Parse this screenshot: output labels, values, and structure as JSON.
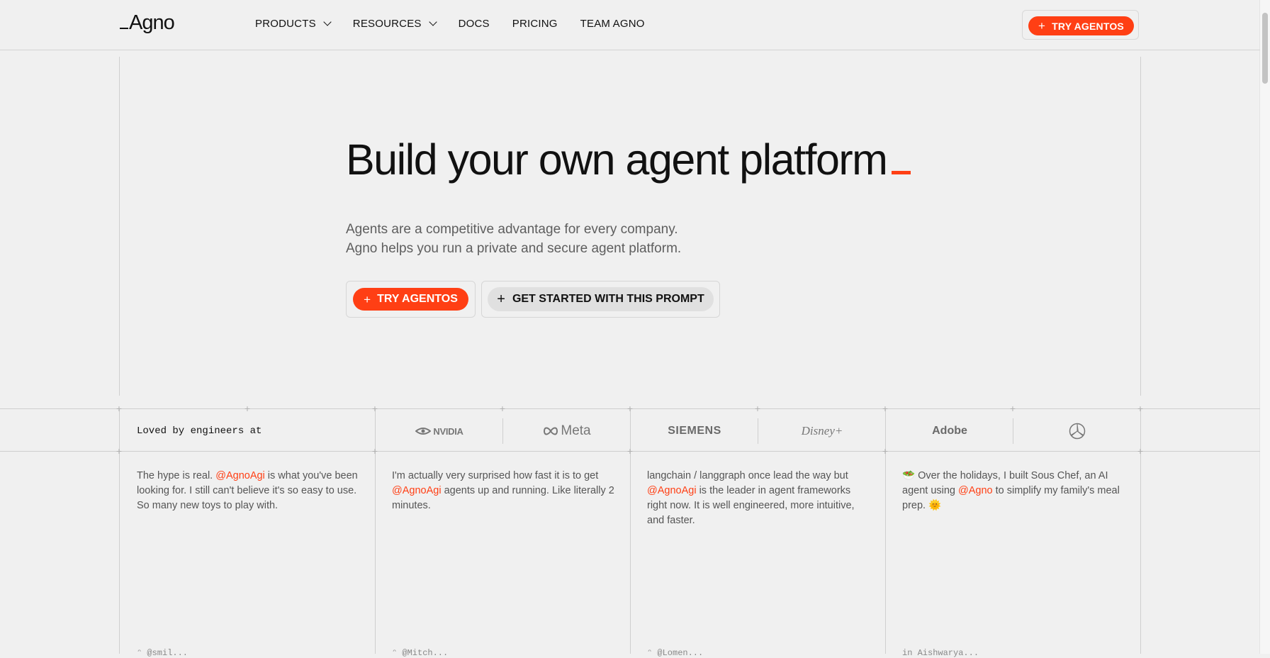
{
  "header": {
    "logo": "Agno",
    "nav": [
      {
        "label": "PRODUCTS",
        "dropdown": true
      },
      {
        "label": "RESOURCES",
        "dropdown": true
      },
      {
        "label": "DOCS",
        "dropdown": false
      },
      {
        "label": "PRICING",
        "dropdown": false
      },
      {
        "label": "TEAM AGNO",
        "dropdown": false
      }
    ],
    "cta_label": "TRY AGENTOS"
  },
  "hero": {
    "title": "Build your own agent platform",
    "subtitle_line1": "Agents are a competitive advantage for every company.",
    "subtitle_line2": "Agno helps you run a private and secure agent platform.",
    "primary_cta": "TRY AGENTOS",
    "secondary_cta": "GET STARTED WITH THIS PROMPT"
  },
  "logos": {
    "heading": "Loved by engineers at",
    "brands": [
      "NVIDIA",
      "Meta",
      "SIEMENS",
      "Disney+",
      "Adobe",
      "Mercedes-Benz"
    ]
  },
  "testimonials": [
    {
      "pre": "The hype is real. ",
      "mention": "@AgnoAgi",
      "post": " is what you've been looking for. I still can't believe it's so easy to use. So many new toys to play with.",
      "author": "ᵔ @smil..."
    },
    {
      "pre": "I'm actually very surprised how fast it is to get ",
      "mention": "@AgnoAgi",
      "post": " agents up and running. Like literally 2 minutes.",
      "author": "ᵔ @Mitch..."
    },
    {
      "pre": "langchain / langgraph once lead the way but ",
      "mention": "@AgnoAgi",
      "post": " is the leader in agent frameworks right now. It is well engineered, more intuitive, and faster.",
      "author": "ᵔ @Lomen..."
    },
    {
      "pre": "🥗 Over the holidays, I built Sous Chef, an AI agent using ",
      "mention": "@Agno",
      "post": " to simplify my family's meal prep. 🌞",
      "author": "in Aishwarya..."
    }
  ],
  "colors": {
    "accent": "#ff3f14",
    "background": "#f0f0f0"
  }
}
